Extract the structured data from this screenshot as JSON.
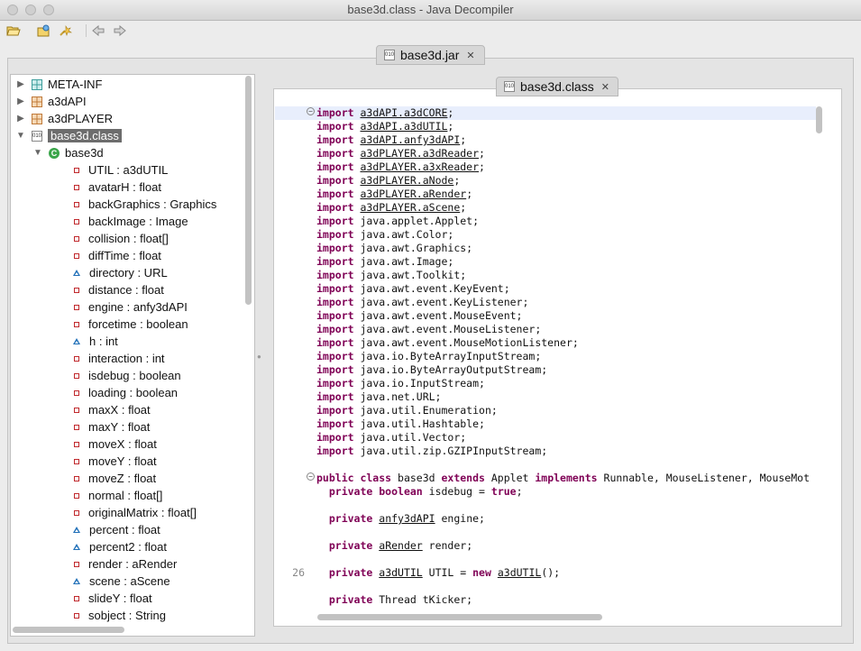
{
  "window": {
    "title": "base3d.class - Java Decompiler"
  },
  "toolbar": {
    "buttons": [
      {
        "icon": "open-folder-icon"
      },
      {
        "icon": "open-file-icon"
      },
      {
        "icon": "search-icon"
      },
      {
        "icon": "back-arrow-icon"
      },
      {
        "icon": "forward-arrow-icon"
      }
    ]
  },
  "tabs": {
    "outer": {
      "label": "base3d.jar",
      "close": "✕"
    },
    "inner": {
      "label": "base3d.class",
      "close": "✕"
    }
  },
  "tree": {
    "nodes": [
      {
        "label": "META-INF",
        "kind": "package-meta",
        "twisty": "▶",
        "level": 0
      },
      {
        "label": "a3dAPI",
        "kind": "package",
        "twisty": "▶",
        "level": 0
      },
      {
        "label": "a3dPLAYER",
        "kind": "package",
        "twisty": "▶",
        "level": 0
      },
      {
        "label": "base3d.class",
        "kind": "file",
        "twisty": "▼",
        "level": 0,
        "selected": true
      },
      {
        "label": "base3d",
        "kind": "class",
        "twisty": "▼",
        "level": 1
      },
      {
        "label": "UTIL : a3dUTIL",
        "kind": "private",
        "level": 2
      },
      {
        "label": "avatarH : float",
        "kind": "private",
        "level": 2
      },
      {
        "label": "backGraphics : Graphics",
        "kind": "private",
        "level": 2
      },
      {
        "label": "backImage : Image",
        "kind": "private",
        "level": 2
      },
      {
        "label": "collision : float[]",
        "kind": "private",
        "level": 2
      },
      {
        "label": "diffTime : float",
        "kind": "private",
        "level": 2
      },
      {
        "label": "directory : URL",
        "kind": "protected",
        "level": 2
      },
      {
        "label": "distance : float",
        "kind": "private",
        "level": 2
      },
      {
        "label": "engine : anfy3dAPI",
        "kind": "private",
        "level": 2
      },
      {
        "label": "forcetime : boolean",
        "kind": "private",
        "level": 2
      },
      {
        "label": "h : int",
        "kind": "protected",
        "level": 2
      },
      {
        "label": "interaction : int",
        "kind": "private",
        "level": 2
      },
      {
        "label": "isdebug : boolean",
        "kind": "private",
        "level": 2
      },
      {
        "label": "loading : boolean",
        "kind": "private",
        "level": 2
      },
      {
        "label": "maxX : float",
        "kind": "private",
        "level": 2
      },
      {
        "label": "maxY : float",
        "kind": "private",
        "level": 2
      },
      {
        "label": "moveX : float",
        "kind": "private",
        "level": 2
      },
      {
        "label": "moveY : float",
        "kind": "private",
        "level": 2
      },
      {
        "label": "moveZ : float",
        "kind": "private",
        "level": 2
      },
      {
        "label": "normal : float[]",
        "kind": "private",
        "level": 2
      },
      {
        "label": "originalMatrix : float[]",
        "kind": "private",
        "level": 2
      },
      {
        "label": "percent : float",
        "kind": "protected",
        "level": 2
      },
      {
        "label": "percent2 : float",
        "kind": "protected",
        "level": 2
      },
      {
        "label": "render : aRender",
        "kind": "private",
        "level": 2
      },
      {
        "label": "scene : aScene",
        "kind": "protected",
        "level": 2
      },
      {
        "label": "slideY : float",
        "kind": "private",
        "level": 2
      },
      {
        "label": "sobject : String",
        "kind": "private",
        "level": 2
      }
    ]
  },
  "code": {
    "lines": [
      {
        "no": "",
        "fold": "⊖",
        "hl": true,
        "parts": [
          [
            "kw",
            "import"
          ],
          [
            "t",
            " "
          ],
          [
            "ul",
            "a3dAPI.a3dCORE"
          ],
          [
            "t",
            ";"
          ]
        ]
      },
      {
        "no": "",
        "parts": [
          [
            "kw",
            "import"
          ],
          [
            "t",
            " "
          ],
          [
            "ul",
            "a3dAPI.a3dUTIL"
          ],
          [
            "t",
            ";"
          ]
        ]
      },
      {
        "no": "",
        "parts": [
          [
            "kw",
            "import"
          ],
          [
            "t",
            " "
          ],
          [
            "ul",
            "a3dAPI.anfy3dAPI"
          ],
          [
            "t",
            ";"
          ]
        ]
      },
      {
        "no": "",
        "parts": [
          [
            "kw",
            "import"
          ],
          [
            "t",
            " "
          ],
          [
            "ul",
            "a3dPLAYER.a3dReader"
          ],
          [
            "t",
            ";"
          ]
        ]
      },
      {
        "no": "",
        "parts": [
          [
            "kw",
            "import"
          ],
          [
            "t",
            " "
          ],
          [
            "ul",
            "a3dPLAYER.a3xReader"
          ],
          [
            "t",
            ";"
          ]
        ]
      },
      {
        "no": "",
        "parts": [
          [
            "kw",
            "import"
          ],
          [
            "t",
            " "
          ],
          [
            "ul",
            "a3dPLAYER.aNode"
          ],
          [
            "t",
            ";"
          ]
        ]
      },
      {
        "no": "",
        "parts": [
          [
            "kw",
            "import"
          ],
          [
            "t",
            " "
          ],
          [
            "ul",
            "a3dPLAYER.aRender"
          ],
          [
            "t",
            ";"
          ]
        ]
      },
      {
        "no": "",
        "parts": [
          [
            "kw",
            "import"
          ],
          [
            "t",
            " "
          ],
          [
            "ul",
            "a3dPLAYER.aScene"
          ],
          [
            "t",
            ";"
          ]
        ]
      },
      {
        "no": "",
        "parts": [
          [
            "kw",
            "import"
          ],
          [
            "t",
            " java.applet.Applet;"
          ]
        ]
      },
      {
        "no": "",
        "parts": [
          [
            "kw",
            "import"
          ],
          [
            "t",
            " java.awt.Color;"
          ]
        ]
      },
      {
        "no": "",
        "parts": [
          [
            "kw",
            "import"
          ],
          [
            "t",
            " java.awt.Graphics;"
          ]
        ]
      },
      {
        "no": "",
        "parts": [
          [
            "kw",
            "import"
          ],
          [
            "t",
            " java.awt.Image;"
          ]
        ]
      },
      {
        "no": "",
        "parts": [
          [
            "kw",
            "import"
          ],
          [
            "t",
            " java.awt.Toolkit;"
          ]
        ]
      },
      {
        "no": "",
        "parts": [
          [
            "kw",
            "import"
          ],
          [
            "t",
            " java.awt.event.KeyEvent;"
          ]
        ]
      },
      {
        "no": "",
        "parts": [
          [
            "kw",
            "import"
          ],
          [
            "t",
            " java.awt.event.KeyListener;"
          ]
        ]
      },
      {
        "no": "",
        "parts": [
          [
            "kw",
            "import"
          ],
          [
            "t",
            " java.awt.event.MouseEvent;"
          ]
        ]
      },
      {
        "no": "",
        "parts": [
          [
            "kw",
            "import"
          ],
          [
            "t",
            " java.awt.event.MouseListener;"
          ]
        ]
      },
      {
        "no": "",
        "parts": [
          [
            "kw",
            "import"
          ],
          [
            "t",
            " java.awt.event.MouseMotionListener;"
          ]
        ]
      },
      {
        "no": "",
        "parts": [
          [
            "kw",
            "import"
          ],
          [
            "t",
            " java.io.ByteArrayInputStream;"
          ]
        ]
      },
      {
        "no": "",
        "parts": [
          [
            "kw",
            "import"
          ],
          [
            "t",
            " java.io.ByteArrayOutputStream;"
          ]
        ]
      },
      {
        "no": "",
        "parts": [
          [
            "kw",
            "import"
          ],
          [
            "t",
            " java.io.InputStream;"
          ]
        ]
      },
      {
        "no": "",
        "parts": [
          [
            "kw",
            "import"
          ],
          [
            "t",
            " java.net.URL;"
          ]
        ]
      },
      {
        "no": "",
        "parts": [
          [
            "kw",
            "import"
          ],
          [
            "t",
            " java.util.Enumeration;"
          ]
        ]
      },
      {
        "no": "",
        "parts": [
          [
            "kw",
            "import"
          ],
          [
            "t",
            " java.util.Hashtable;"
          ]
        ]
      },
      {
        "no": "",
        "parts": [
          [
            "kw",
            "import"
          ],
          [
            "t",
            " java.util.Vector;"
          ]
        ]
      },
      {
        "no": "",
        "parts": [
          [
            "kw",
            "import"
          ],
          [
            "t",
            " java.util.zip.GZIPInputStream;"
          ]
        ]
      },
      {
        "no": "",
        "parts": []
      },
      {
        "no": "",
        "fold": "⊖",
        "parts": [
          [
            "kw",
            "public class"
          ],
          [
            "t",
            " base3d "
          ],
          [
            "kw",
            "extends"
          ],
          [
            "t",
            " Applet "
          ],
          [
            "kw",
            "implements"
          ],
          [
            "t",
            " Runnable, MouseListener, MouseMot"
          ]
        ]
      },
      {
        "no": "",
        "parts": [
          [
            "t",
            "  "
          ],
          [
            "kw",
            "private boolean"
          ],
          [
            "t",
            " isdebug = "
          ],
          [
            "kw",
            "true"
          ],
          [
            "t",
            ";"
          ]
        ]
      },
      {
        "no": "",
        "parts": []
      },
      {
        "no": "",
        "parts": [
          [
            "t",
            "  "
          ],
          [
            "kw",
            "private"
          ],
          [
            "t",
            " "
          ],
          [
            "ul",
            "anfy3dAPI"
          ],
          [
            "t",
            " engine;"
          ]
        ]
      },
      {
        "no": "",
        "parts": []
      },
      {
        "no": "",
        "parts": [
          [
            "t",
            "  "
          ],
          [
            "kw",
            "private"
          ],
          [
            "t",
            " "
          ],
          [
            "ul",
            "aRender"
          ],
          [
            "t",
            " render;"
          ]
        ]
      },
      {
        "no": "",
        "parts": []
      },
      {
        "no": "26",
        "parts": [
          [
            "t",
            "  "
          ],
          [
            "kw",
            "private"
          ],
          [
            "t",
            " "
          ],
          [
            "ul",
            "a3dUTIL"
          ],
          [
            "t",
            " UTIL = "
          ],
          [
            "kw",
            "new"
          ],
          [
            "t",
            " "
          ],
          [
            "ul",
            "a3dUTIL"
          ],
          [
            "t",
            "();"
          ]
        ]
      },
      {
        "no": "",
        "parts": []
      },
      {
        "no": "",
        "parts": [
          [
            "t",
            "  "
          ],
          [
            "kw",
            "private"
          ],
          [
            "t",
            " Thread tKicker;"
          ]
        ]
      }
    ]
  }
}
